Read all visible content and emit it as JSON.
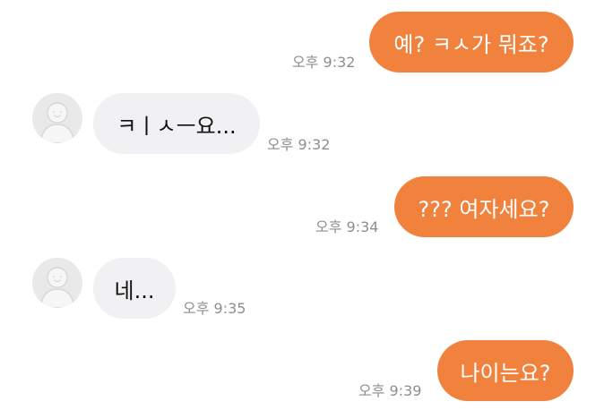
{
  "messages": [
    {
      "direction": "outgoing",
      "text": "예? ㅋㅅ가 뭐죠?",
      "time": "오후 9:32"
    },
    {
      "direction": "incoming",
      "text": "ㅋㅣㅅㅡ요...",
      "time": "오후 9:32",
      "avatar_icon": "default-profile-icon"
    },
    {
      "direction": "outgoing",
      "text": "??? 여자세요?",
      "time": "오후 9:34"
    },
    {
      "direction": "incoming",
      "text": "네...",
      "time": "오후 9:35",
      "avatar_icon": "default-profile-icon"
    },
    {
      "direction": "outgoing",
      "text": "나이는요?",
      "time": "오후 9:39"
    }
  ],
  "colors": {
    "outgoing_bubble": "#f0823d",
    "incoming_bubble": "#f1f1f3",
    "timestamp": "#8e8e8e",
    "background": "#ffffff"
  }
}
